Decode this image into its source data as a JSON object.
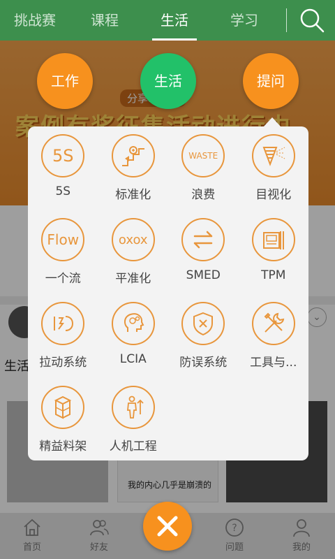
{
  "top_tabs": [
    {
      "label": "挑战赛"
    },
    {
      "label": "课程"
    },
    {
      "label": "生活"
    },
    {
      "label": "学习"
    }
  ],
  "banner": {
    "subtitle": "分享…生活",
    "headline": "案例有奖征集活动进行中"
  },
  "categories": {
    "work": "工作",
    "life": "生活",
    "ask": "提问"
  },
  "menu_items": [
    {
      "label": "5S",
      "icon": "5s-icon",
      "icon_text": "5S"
    },
    {
      "label": "标准化",
      "icon": "standardization-icon"
    },
    {
      "label": "浪费",
      "icon": "waste-icon",
      "icon_text": "WASTE"
    },
    {
      "label": "目视化",
      "icon": "visualization-icon"
    },
    {
      "label": "一个流",
      "icon": "flow-icon",
      "icon_text": "Flow"
    },
    {
      "label": "平准化",
      "icon": "leveling-icon",
      "icon_text": "oxox"
    },
    {
      "label": "SMED",
      "icon": "smed-icon"
    },
    {
      "label": "TPM",
      "icon": "tpm-icon"
    },
    {
      "label": "拉动系统",
      "icon": "pull-system-icon"
    },
    {
      "label": "LCIA",
      "icon": "lcia-icon"
    },
    {
      "label": "防误系统",
      "icon": "error-proofing-icon"
    },
    {
      "label": "工具与...",
      "icon": "tools-icon"
    },
    {
      "label": "精益料架",
      "icon": "lean-rack-icon"
    },
    {
      "label": "人机工程",
      "icon": "ergonomics-icon"
    }
  ],
  "feed": {
    "post_text": "生活",
    "post_caption": "我的内心几乎是崩溃的"
  },
  "bottom_nav": [
    {
      "label": "首页",
      "icon": "home-icon"
    },
    {
      "label": "好友",
      "icon": "friends-icon"
    },
    {
      "label": "问题",
      "icon": "question-icon"
    },
    {
      "label": "我的",
      "icon": "profile-icon"
    }
  ],
  "colors": {
    "nav_green": "#3d8f4d",
    "accent_orange": "#f7911e",
    "life_green": "#22c169",
    "icon_orange": "#e8963c"
  }
}
